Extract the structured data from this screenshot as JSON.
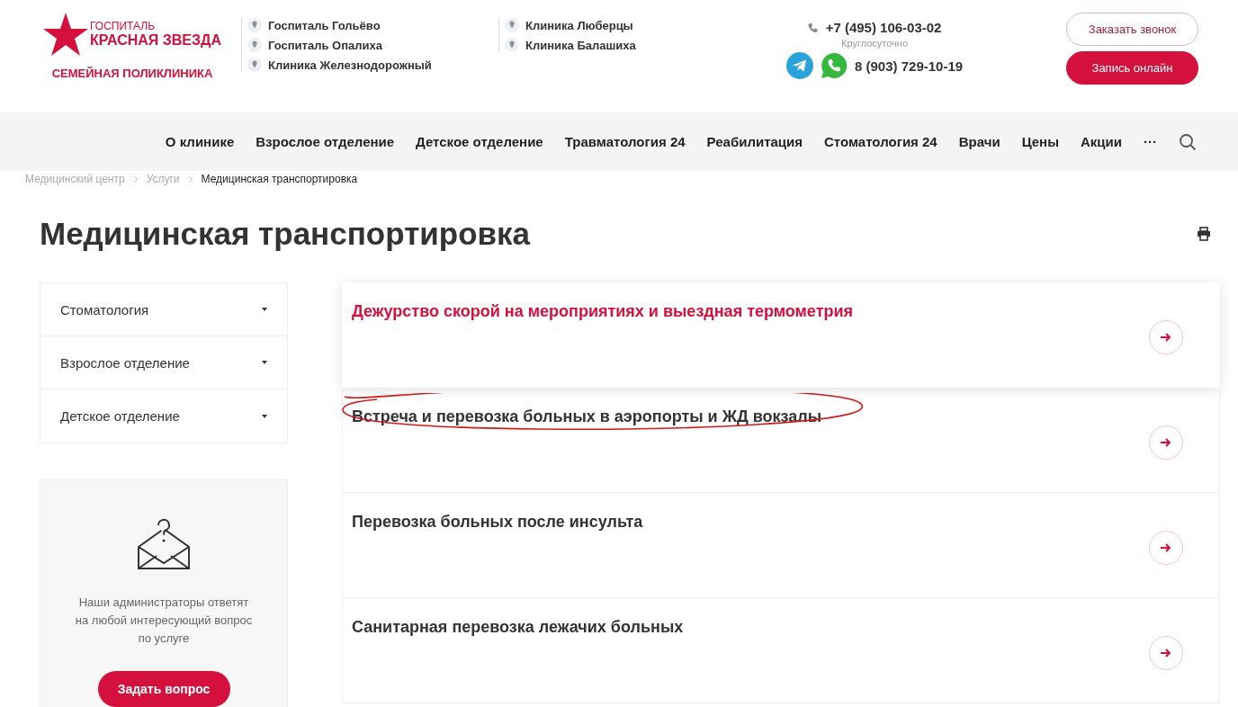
{
  "logo": {
    "line_1": "ГОСПИТАЛЬ",
    "line_2": "КРАСНАЯ ЗВЕЗДА",
    "subtitle": "СЕМЕЙНАЯ ПОЛИКЛИНИКА"
  },
  "locations": [
    [
      "Госпиталь Гольёво",
      "Госпиталь Опалиха",
      "Клиника Железнодорожный"
    ],
    [
      "Клиника Люберцы",
      "Клиника Балашиха"
    ]
  ],
  "contacts": {
    "phone": "+7 (495) 106-03-02",
    "hours": "Круглосуточно",
    "mobile": "8 (903) 729-10-19"
  },
  "buttons": {
    "callback": "Заказать звонок",
    "book": "Запись онлайн"
  },
  "nav": {
    "items": [
      "О клинике",
      "Взрослое отделение",
      "Детское отделение",
      "Травматология 24",
      "Реабилитация",
      "Стоматология 24",
      "Врачи",
      "Цены",
      "Акции"
    ],
    "more": "···"
  },
  "breadcrumbs": [
    {
      "label": "Медицинский центр",
      "current": false
    },
    {
      "label": "Услуги",
      "current": false
    },
    {
      "label": "Медицинская транспортировка",
      "current": true
    }
  ],
  "title": "Медицинская транспортировка",
  "sidebar": {
    "items": [
      "Стоматология",
      "Взрослое отделение",
      "Детское отделение"
    ],
    "question": {
      "text": "Наши администраторы ответят на любой интересующий вопрос по услуге",
      "button": "Задать вопрос"
    }
  },
  "services": [
    {
      "title": "Дежурство скорой на мероприятиях и выездная термометрия",
      "highlighted": true,
      "annotated": false
    },
    {
      "title": "Встреча и перевозка больных в аэропорты и ЖД вокзалы",
      "highlighted": false,
      "annotated": true
    },
    {
      "title": "Перевозка больных после инсульта",
      "highlighted": false,
      "annotated": false
    },
    {
      "title": "Санитарная перевозка лежачих больных",
      "highlighted": false,
      "annotated": false
    }
  ]
}
